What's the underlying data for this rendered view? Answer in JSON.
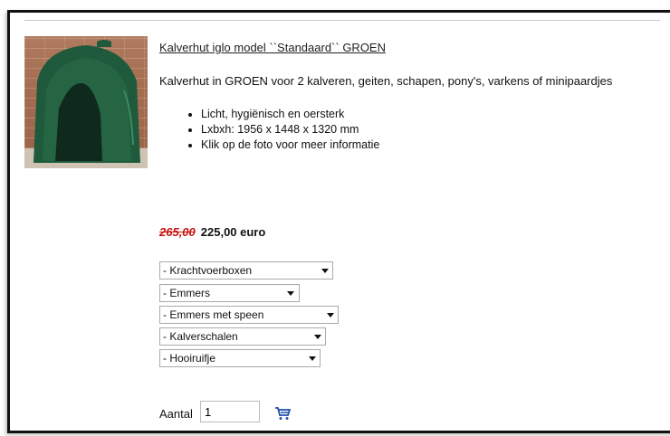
{
  "product": {
    "title": "Kalverhut iglo model ``Standaard`` GROEN",
    "description": "Kalverhut in GROEN voor 2 kalveren, geiten, schapen, pony's, varkens of minipaardjes",
    "features": [
      "Licht, hygiënisch en oersterk",
      "Lxbxh: 1956 x 1448 x 1320 mm",
      "Klik op de foto voor meer informatie"
    ],
    "old_price": "265,00",
    "new_price": "225,00 euro"
  },
  "options": [
    "- Krachtvoerboxen",
    "- Emmers",
    "- Emmers met speen",
    "- Kalverschalen",
    "- Hooiruifje"
  ],
  "quantity": {
    "label": "Aantal",
    "value": "1"
  },
  "icons": {
    "photo": "calf-hutch-photo",
    "cart": "cart-icon"
  },
  "colors": {
    "old_price": "#c81010",
    "hutch_green": "#1f5a3c"
  }
}
